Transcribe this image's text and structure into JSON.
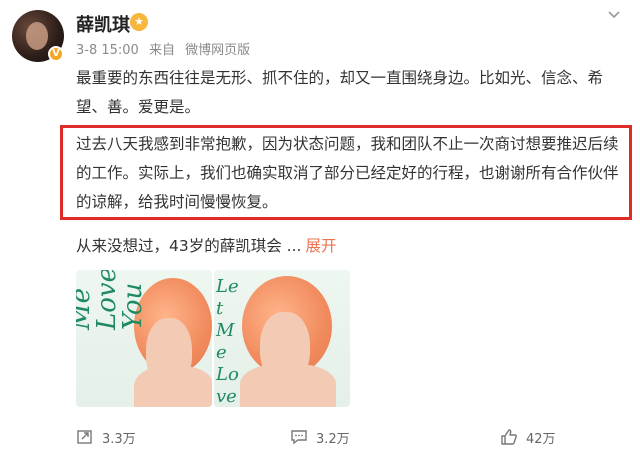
{
  "post": {
    "author": "薛凯琪",
    "time": "3-8 15:00",
    "from_label": "来自",
    "source": "微博网页版",
    "paragraph1": "最重要的东西往往是无形、抓不住的，却又一直围绕身边。比如光、信念、希望、善。爱更是。",
    "paragraph2": "过去八天我感到非常抱歉，因为状态问题，我和团队不止一次商讨想要推迟后续的工作。实际上，我们也确实取消了部分已经定好的行程，也谢谢所有合作伙伴的谅解，给我时间慢慢恢复。",
    "paragraph3": "从来没想过，43岁的薛凯琪会 ...",
    "expand_label": "展开"
  },
  "images": [
    {
      "caption": "Me Love You"
    },
    {
      "caption": "Let Me Love You"
    }
  ],
  "actions": {
    "repost": "3.3万",
    "comment": "3.2万",
    "like": "42万"
  },
  "colors": {
    "highlight_border": "#e02b2b",
    "link": "#eb7350",
    "verified": "#f5a623"
  },
  "icons": [
    "verified-icon",
    "vip-icon",
    "chevron-down-icon",
    "repost-icon",
    "comment-icon",
    "like-icon"
  ]
}
